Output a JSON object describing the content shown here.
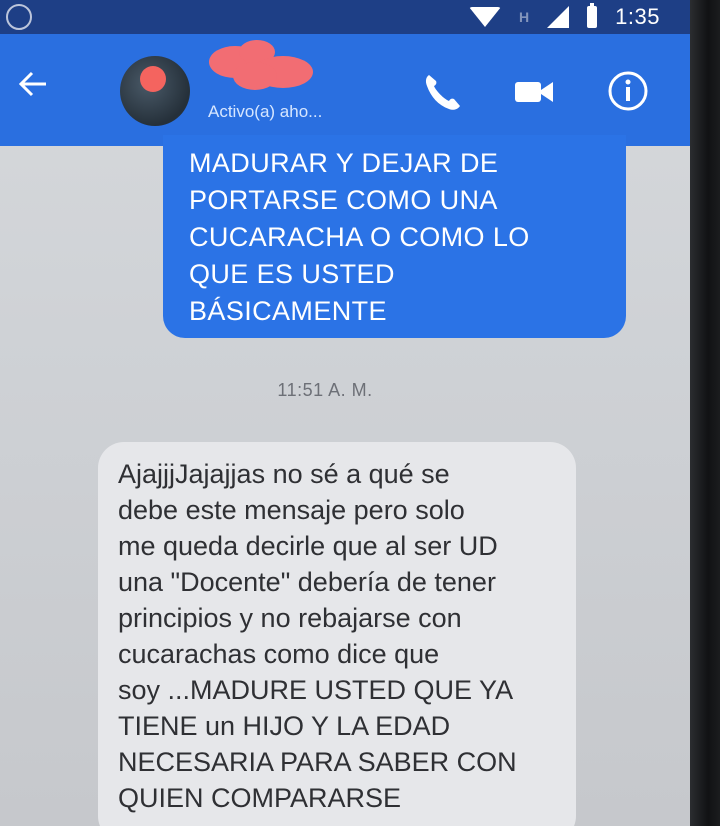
{
  "status_bar": {
    "time": "1:35",
    "network_mark": "H",
    "icons": [
      "messenger-icon",
      "wifi-icon",
      "signal-icon",
      "battery-icon"
    ]
  },
  "header": {
    "active_status": "Activo(a) aho...",
    "icons": [
      "back-arrow-icon",
      "phone-icon",
      "video-camera-icon",
      "info-icon"
    ],
    "accent_color": "#2a6fe0"
  },
  "messages": {
    "sent": {
      "text": "MADURAR Y DEJAR DE\nPORTARSE COMO UNA\nCUCARACHA O COMO LO\nQUE ES USTED\nBÁSICAMENTE",
      "bubble_color": "#2b73e6"
    },
    "timestamp": "11:51 A. M.",
    "received": {
      "text": "AjajjjJajajjas no sé a qué se\ndebe este mensaje pero solo\nme queda decirle que al ser UD\nuna \"Docente\" debería de tener\nprincipios y no rebajarse con\ncucarachas como dice que\nsoy ...MADURE USTED QUE YA\nTIENE un HIJO Y LA EDAD\nNECESARIA PARA SABER CON\nQUIEN COMPARARSE",
      "bubble_color": "#e6e7ea"
    }
  }
}
